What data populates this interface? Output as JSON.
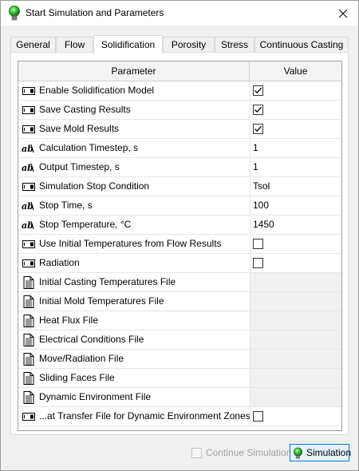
{
  "window": {
    "title": "Start Simulation and Parameters"
  },
  "tabs": [
    {
      "label": "General"
    },
    {
      "label": "Flow"
    },
    {
      "label": "Solidification"
    },
    {
      "label": "Porosity"
    },
    {
      "label": "Stress"
    },
    {
      "label": "Continuous Casting"
    }
  ],
  "active_tab": "Solidification",
  "grid": {
    "header_parameter": "Parameter",
    "header_value": "Value",
    "rows": [
      {
        "icon": "toggle-icon",
        "label": "Enable Solidification Model",
        "value_type": "checkbox",
        "checked": true
      },
      {
        "icon": "toggle-icon",
        "label": "Save Casting Results",
        "value_type": "checkbox",
        "checked": true
      },
      {
        "icon": "toggle-icon",
        "label": "Save Mold Results",
        "value_type": "checkbox",
        "checked": true
      },
      {
        "icon": "numeric-icon",
        "label": "Calculation Timestep, s",
        "value_type": "text",
        "value": "1"
      },
      {
        "icon": "numeric-icon",
        "label": "Output Timestep, s",
        "value_type": "text",
        "value": "1"
      },
      {
        "icon": "toggle-icon",
        "label": "Simulation Stop Condition",
        "value_type": "text",
        "value": "Tsol"
      },
      {
        "icon": "numeric-icon",
        "label": "Stop Time, s",
        "value_type": "text",
        "value": "100"
      },
      {
        "icon": "numeric-icon",
        "label": "Stop Temperature, °C",
        "value_type": "text",
        "value": "1450"
      },
      {
        "icon": "toggle-icon",
        "label": "Use Initial Temperatures from Flow Results",
        "value_type": "checkbox",
        "checked": false
      },
      {
        "icon": "toggle-icon",
        "label": "Radiation",
        "value_type": "checkbox",
        "checked": false
      },
      {
        "icon": "file-icon",
        "label": "Initial Casting Temperatures File",
        "value_type": "empty",
        "value": ""
      },
      {
        "icon": "file-icon",
        "label": "Initial Mold Temperatures File",
        "value_type": "empty",
        "value": ""
      },
      {
        "icon": "file-icon",
        "label": "Heat Flux File",
        "value_type": "empty",
        "value": ""
      },
      {
        "icon": "file-icon",
        "label": "Electrical Conditions File",
        "value_type": "empty",
        "value": ""
      },
      {
        "icon": "file-icon",
        "label": "Move/Radiation File",
        "value_type": "empty",
        "value": ""
      },
      {
        "icon": "file-icon",
        "label": "Sliding Faces File",
        "value_type": "empty",
        "value": ""
      },
      {
        "icon": "file-icon",
        "label": "Dynamic Environment File",
        "value_type": "empty",
        "value": ""
      },
      {
        "icon": "toggle-icon",
        "label": "...at Transfer File for Dynamic Environment Zones",
        "value_type": "checkbox",
        "checked": false
      }
    ]
  },
  "footer": {
    "continue_label": "Continue Simulation",
    "continue_checked": false,
    "continue_enabled": false,
    "simulation_label": "Simulation"
  },
  "colors": {
    "accent": "#0078d7",
    "button_bg": "#e5f1fb",
    "status_green": "#3cc23c"
  }
}
